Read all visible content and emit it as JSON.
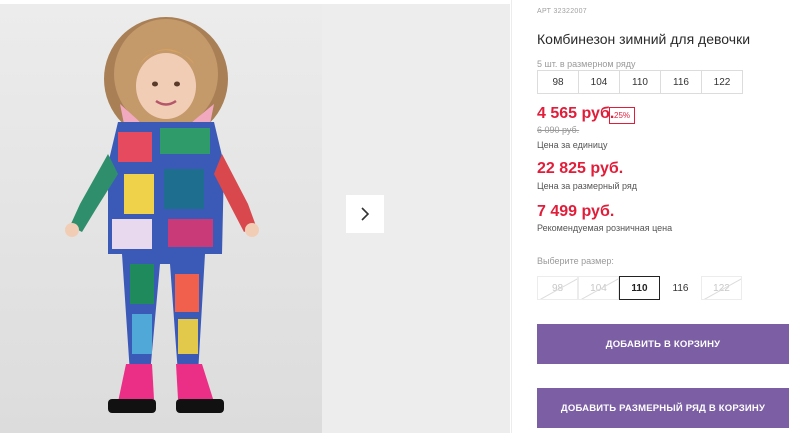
{
  "product": {
    "article": "АРТ 32322007",
    "title": "Комбинезон зимний для девочки"
  },
  "size_row": {
    "label": "5 шт. в размерном ряду",
    "sizes": [
      "98",
      "104",
      "110",
      "116",
      "122"
    ]
  },
  "prices": {
    "unit_price": "4 565 руб.",
    "discount": "25%",
    "old_price": "6 090 руб.",
    "unit_label": "Цена за единицу",
    "row_price": "22 825 руб.",
    "row_label": "Цена за размерный ряд",
    "retail_price": "7 499 руб.",
    "retail_label": "Рекомендуемая розничная цена"
  },
  "size_select": {
    "label": "Выберите размер:",
    "options": [
      "98",
      "104",
      "110",
      "116",
      "122"
    ],
    "selected": "110"
  },
  "buttons": {
    "add_to_cart": "ДОБАВИТЬ В КОРЗИНУ",
    "add_row_to_cart": "ДОБАВИТЬ РАЗМЕРНЫЙ РЯД В КОРЗИНУ"
  },
  "colors": {
    "price_red": "#e11d3a",
    "button_purple": "#7b5ea3"
  },
  "icons": {
    "next": "chevron-right-icon"
  }
}
